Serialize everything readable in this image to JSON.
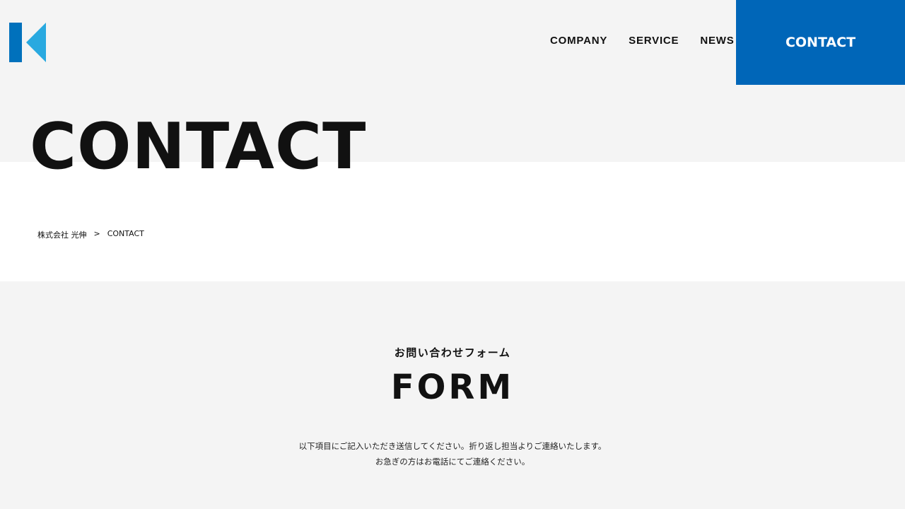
{
  "header": {
    "nav": [
      "COMPANY",
      "SERVICE",
      "NEWS"
    ],
    "contact_label": "CONTACT",
    "accent_color": "#0066b8",
    "logo_colors": [
      "#0071bc",
      "#29a9e0"
    ]
  },
  "hero": {
    "title": "CONTACT"
  },
  "breadcrumb": {
    "home": "株式会社 光伸",
    "separator": ">",
    "current": "CONTACT"
  },
  "form": {
    "subtitle": "お問い合わせフォーム",
    "title": "FORM",
    "desc_line1": "以下項目にご記入いただき送信してください。折り返し担当よりご連絡いたします。",
    "desc_line2": "お急ぎの方はお電話にてご連絡ください。"
  }
}
